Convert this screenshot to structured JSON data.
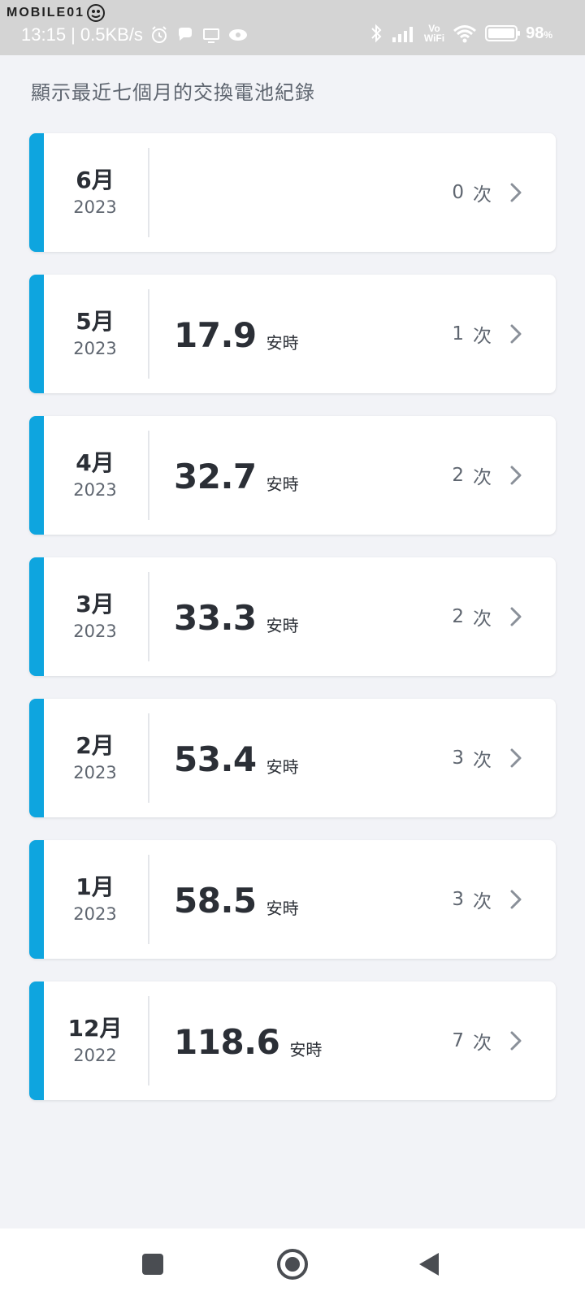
{
  "status_bar": {
    "watermark": "MOBILE01",
    "time": "13:15",
    "net_speed": "| 0.5KB/s",
    "vowifi_top": "Vo",
    "vowifi_bottom": "WiFi",
    "battery": "98",
    "battery_unit": "%",
    "icons": [
      "alarm-icon",
      "chat-icon",
      "tv-icon",
      "eye-icon",
      "bluetooth-icon",
      "signal-icon",
      "wifi-icon",
      "battery-icon"
    ]
  },
  "header": {
    "text": "顯示最近七個月的交換電池紀錄"
  },
  "records": [
    {
      "month": "6月",
      "year": "2023",
      "amount": "",
      "unit": "",
      "count": "0",
      "count_unit": "次"
    },
    {
      "month": "5月",
      "year": "2023",
      "amount": "17.9",
      "unit": "安時",
      "count": "1",
      "count_unit": "次"
    },
    {
      "month": "4月",
      "year": "2023",
      "amount": "32.7",
      "unit": "安時",
      "count": "2",
      "count_unit": "次"
    },
    {
      "month": "3月",
      "year": "2023",
      "amount": "33.3",
      "unit": "安時",
      "count": "2",
      "count_unit": "次"
    },
    {
      "month": "2月",
      "year": "2023",
      "amount": "53.4",
      "unit": "安時",
      "count": "3",
      "count_unit": "次"
    },
    {
      "month": "1月",
      "year": "2023",
      "amount": "58.5",
      "unit": "安時",
      "count": "3",
      "count_unit": "次"
    },
    {
      "month": "12月",
      "year": "2022",
      "amount": "118.6",
      "unit": "安時",
      "count": "7",
      "count_unit": "次"
    }
  ],
  "colors": {
    "accent": "#0ea5df",
    "background": "#f2f3f7",
    "card": "#ffffff",
    "text_primary": "#2b2f36",
    "text_secondary": "#5f6670"
  },
  "nav": {
    "buttons": [
      "recents-square-icon",
      "home-circle-icon",
      "back-triangle-icon"
    ]
  }
}
